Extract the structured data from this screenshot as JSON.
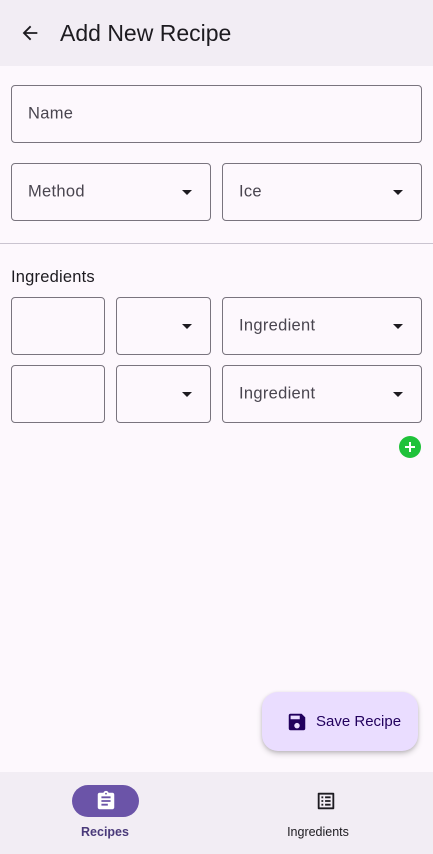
{
  "header": {
    "title": "Add New Recipe",
    "back_icon": "arrow-back-icon"
  },
  "form": {
    "name_label": "Name",
    "method_label": "Method",
    "ice_value": "Ice",
    "ingredients_heading": "Ingredients",
    "ingredient_rows": [
      {
        "amount": "",
        "unit": "",
        "ingredient_label": "Ingredient"
      },
      {
        "amount": "",
        "unit": "",
        "ingredient_label": "Ingredient"
      }
    ],
    "add_icon": "add-circle-icon",
    "add_color": "#1fc23a"
  },
  "fab": {
    "label": "Save Recipe",
    "icon": "save-icon"
  },
  "bottom_nav": {
    "items": [
      {
        "label": "Recipes",
        "icon": "clipboard-icon",
        "active": true
      },
      {
        "label": "Ingredients",
        "icon": "list-icon",
        "active": false
      }
    ]
  },
  "colors": {
    "accent": "#6b54a8",
    "fab_bg": "#eaddff",
    "surface": "#fdf8fd",
    "bar_bg": "#f2edf4"
  }
}
